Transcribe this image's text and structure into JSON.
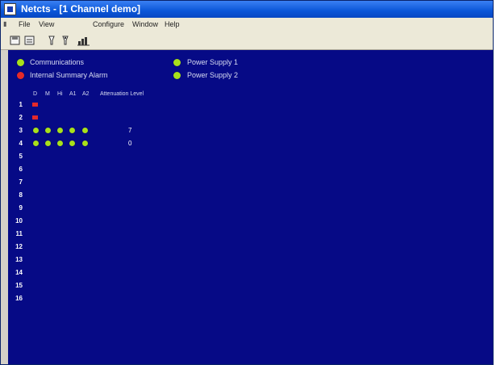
{
  "window": {
    "title": "Netcts - [1 Channel demo]"
  },
  "menubar": {
    "items": [
      "File",
      "View",
      "Configure",
      "Window",
      "Help"
    ]
  },
  "toolbar": {
    "buttons": [
      "save-icon",
      "open-icon",
      "probe-icon",
      "probe-alt-icon",
      "chart-icon"
    ]
  },
  "status": {
    "left": [
      {
        "label": "Communications",
        "state": "green"
      },
      {
        "label": "Internal Summary Alarm",
        "state": "red"
      }
    ],
    "right": [
      {
        "label": "Power Supply 1",
        "state": "green"
      },
      {
        "label": "Power Supply 2",
        "state": "green"
      }
    ]
  },
  "grid": {
    "headers": [
      "D",
      "M",
      "Hi",
      "A1",
      "A2",
      "Attenuation Level"
    ],
    "rows": [
      {
        "num": "1",
        "marker": "red"
      },
      {
        "num": "2",
        "marker": "red"
      },
      {
        "num": "3",
        "leds": [
          "green",
          "green",
          "green",
          "green",
          "green"
        ],
        "attenuation": "7"
      },
      {
        "num": "4",
        "leds": [
          "green",
          "green",
          "green",
          "green",
          "green"
        ],
        "attenuation": "0"
      },
      {
        "num": "5"
      },
      {
        "num": "6"
      },
      {
        "num": "7"
      },
      {
        "num": "8"
      },
      {
        "num": "9"
      },
      {
        "num": "10"
      },
      {
        "num": "11"
      },
      {
        "num": "12"
      },
      {
        "num": "13"
      },
      {
        "num": "14"
      },
      {
        "num": "15"
      },
      {
        "num": "16"
      }
    ]
  },
  "colors": {
    "background": "#060a86",
    "ok": "#a8e01b",
    "alarm": "#e52a2a",
    "titlebar": "#0a56d8"
  }
}
